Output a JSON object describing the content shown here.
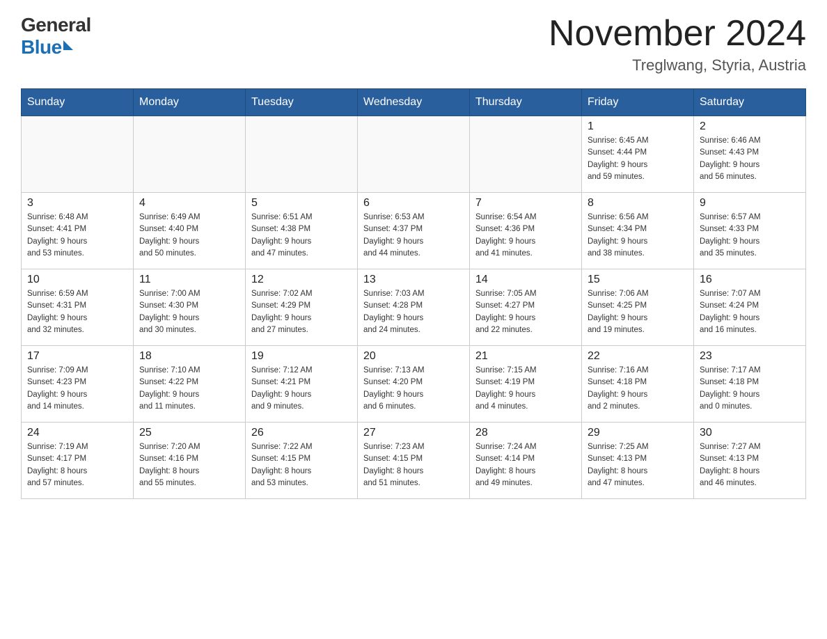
{
  "header": {
    "logo_general": "General",
    "logo_blue": "Blue",
    "month_year": "November 2024",
    "location": "Treglwang, Styria, Austria"
  },
  "days_of_week": [
    "Sunday",
    "Monday",
    "Tuesday",
    "Wednesday",
    "Thursday",
    "Friday",
    "Saturday"
  ],
  "weeks": [
    [
      {
        "day": "",
        "info": ""
      },
      {
        "day": "",
        "info": ""
      },
      {
        "day": "",
        "info": ""
      },
      {
        "day": "",
        "info": ""
      },
      {
        "day": "",
        "info": ""
      },
      {
        "day": "1",
        "info": "Sunrise: 6:45 AM\nSunset: 4:44 PM\nDaylight: 9 hours\nand 59 minutes."
      },
      {
        "day": "2",
        "info": "Sunrise: 6:46 AM\nSunset: 4:43 PM\nDaylight: 9 hours\nand 56 minutes."
      }
    ],
    [
      {
        "day": "3",
        "info": "Sunrise: 6:48 AM\nSunset: 4:41 PM\nDaylight: 9 hours\nand 53 minutes."
      },
      {
        "day": "4",
        "info": "Sunrise: 6:49 AM\nSunset: 4:40 PM\nDaylight: 9 hours\nand 50 minutes."
      },
      {
        "day": "5",
        "info": "Sunrise: 6:51 AM\nSunset: 4:38 PM\nDaylight: 9 hours\nand 47 minutes."
      },
      {
        "day": "6",
        "info": "Sunrise: 6:53 AM\nSunset: 4:37 PM\nDaylight: 9 hours\nand 44 minutes."
      },
      {
        "day": "7",
        "info": "Sunrise: 6:54 AM\nSunset: 4:36 PM\nDaylight: 9 hours\nand 41 minutes."
      },
      {
        "day": "8",
        "info": "Sunrise: 6:56 AM\nSunset: 4:34 PM\nDaylight: 9 hours\nand 38 minutes."
      },
      {
        "day": "9",
        "info": "Sunrise: 6:57 AM\nSunset: 4:33 PM\nDaylight: 9 hours\nand 35 minutes."
      }
    ],
    [
      {
        "day": "10",
        "info": "Sunrise: 6:59 AM\nSunset: 4:31 PM\nDaylight: 9 hours\nand 32 minutes."
      },
      {
        "day": "11",
        "info": "Sunrise: 7:00 AM\nSunset: 4:30 PM\nDaylight: 9 hours\nand 30 minutes."
      },
      {
        "day": "12",
        "info": "Sunrise: 7:02 AM\nSunset: 4:29 PM\nDaylight: 9 hours\nand 27 minutes."
      },
      {
        "day": "13",
        "info": "Sunrise: 7:03 AM\nSunset: 4:28 PM\nDaylight: 9 hours\nand 24 minutes."
      },
      {
        "day": "14",
        "info": "Sunrise: 7:05 AM\nSunset: 4:27 PM\nDaylight: 9 hours\nand 22 minutes."
      },
      {
        "day": "15",
        "info": "Sunrise: 7:06 AM\nSunset: 4:25 PM\nDaylight: 9 hours\nand 19 minutes."
      },
      {
        "day": "16",
        "info": "Sunrise: 7:07 AM\nSunset: 4:24 PM\nDaylight: 9 hours\nand 16 minutes."
      }
    ],
    [
      {
        "day": "17",
        "info": "Sunrise: 7:09 AM\nSunset: 4:23 PM\nDaylight: 9 hours\nand 14 minutes."
      },
      {
        "day": "18",
        "info": "Sunrise: 7:10 AM\nSunset: 4:22 PM\nDaylight: 9 hours\nand 11 minutes."
      },
      {
        "day": "19",
        "info": "Sunrise: 7:12 AM\nSunset: 4:21 PM\nDaylight: 9 hours\nand 9 minutes."
      },
      {
        "day": "20",
        "info": "Sunrise: 7:13 AM\nSunset: 4:20 PM\nDaylight: 9 hours\nand 6 minutes."
      },
      {
        "day": "21",
        "info": "Sunrise: 7:15 AM\nSunset: 4:19 PM\nDaylight: 9 hours\nand 4 minutes."
      },
      {
        "day": "22",
        "info": "Sunrise: 7:16 AM\nSunset: 4:18 PM\nDaylight: 9 hours\nand 2 minutes."
      },
      {
        "day": "23",
        "info": "Sunrise: 7:17 AM\nSunset: 4:18 PM\nDaylight: 9 hours\nand 0 minutes."
      }
    ],
    [
      {
        "day": "24",
        "info": "Sunrise: 7:19 AM\nSunset: 4:17 PM\nDaylight: 8 hours\nand 57 minutes."
      },
      {
        "day": "25",
        "info": "Sunrise: 7:20 AM\nSunset: 4:16 PM\nDaylight: 8 hours\nand 55 minutes."
      },
      {
        "day": "26",
        "info": "Sunrise: 7:22 AM\nSunset: 4:15 PM\nDaylight: 8 hours\nand 53 minutes."
      },
      {
        "day": "27",
        "info": "Sunrise: 7:23 AM\nSunset: 4:15 PM\nDaylight: 8 hours\nand 51 minutes."
      },
      {
        "day": "28",
        "info": "Sunrise: 7:24 AM\nSunset: 4:14 PM\nDaylight: 8 hours\nand 49 minutes."
      },
      {
        "day": "29",
        "info": "Sunrise: 7:25 AM\nSunset: 4:13 PM\nDaylight: 8 hours\nand 47 minutes."
      },
      {
        "day": "30",
        "info": "Sunrise: 7:27 AM\nSunset: 4:13 PM\nDaylight: 8 hours\nand 46 minutes."
      }
    ]
  ]
}
